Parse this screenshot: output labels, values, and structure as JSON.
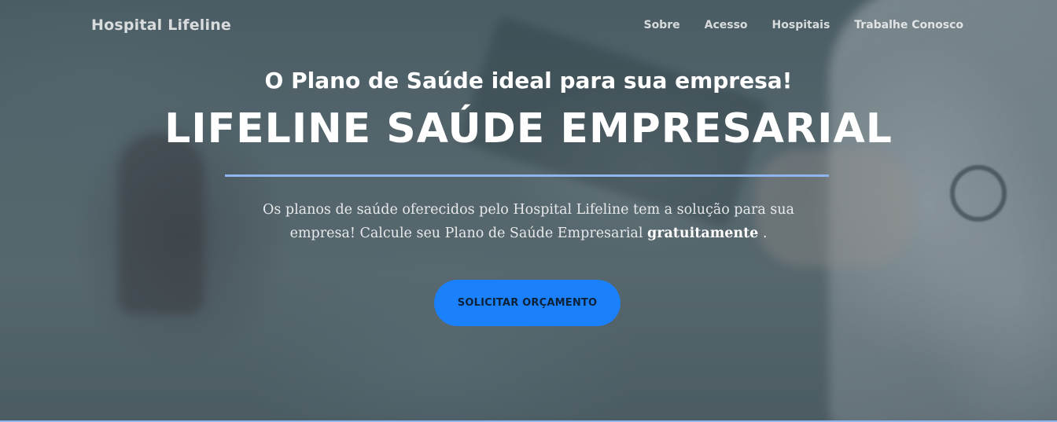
{
  "navbar": {
    "brand": "Hospital Lifeline",
    "links": [
      "Sobre",
      "Acesso",
      "Hospitais",
      "Trabalhe Conosco"
    ]
  },
  "hero": {
    "subtitle": "O Plano de Saúde ideal para sua empresa!",
    "title": "LIFELINE SAÚDE EMPRESARIAL",
    "description_start": "Os planos de saúde oferecidos pelo Hospital Lifeline tem a solução para sua empresa! Calcule seu Plano de Saúde Empresarial ",
    "description_emphasis": "gratuitamente",
    "description_end": " .",
    "cta_label": "SOLICITAR ORÇAMENTO"
  },
  "colors": {
    "accent": "#1b80fb",
    "divider": "#8fb6ef"
  }
}
